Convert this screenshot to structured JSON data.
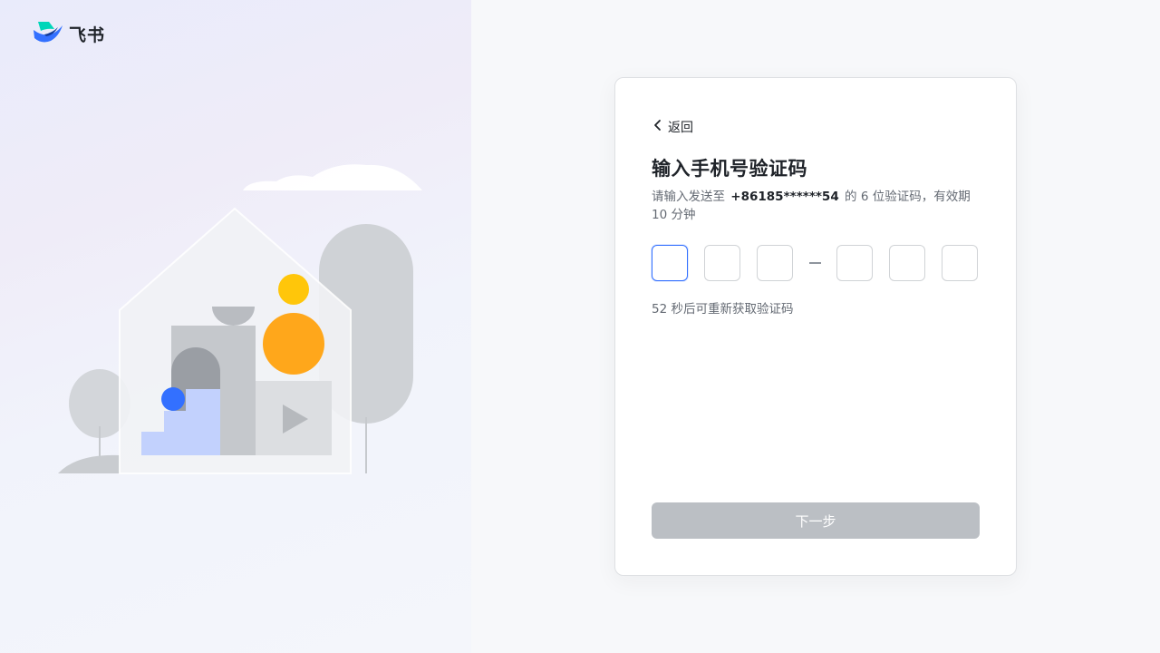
{
  "brand": {
    "name": "飞书",
    "logo_icon": "feishu-logo-icon",
    "colors": {
      "primary": "#3370ff",
      "teal": "#00d6b9"
    }
  },
  "auth": {
    "back_label": "返回",
    "back_icon": "chevron-left-icon",
    "title": "输入手机号验证码",
    "description_prefix": "请输入发送至",
    "phone_masked": "+86185******54",
    "description_suffix": "的 6 位验证码，有效期 10 分钟",
    "code_digits": [
      "",
      "",
      "",
      "",
      "",
      ""
    ],
    "resend_text": "52 秒后可重新获取验证码",
    "next_button_label": "下一步",
    "next_button_state": "disabled"
  },
  "colors": {
    "accent": "#3370ff",
    "disabled_button": "#bbbfc4",
    "text_primary": "#1f2329",
    "text_secondary": "#646a73"
  }
}
